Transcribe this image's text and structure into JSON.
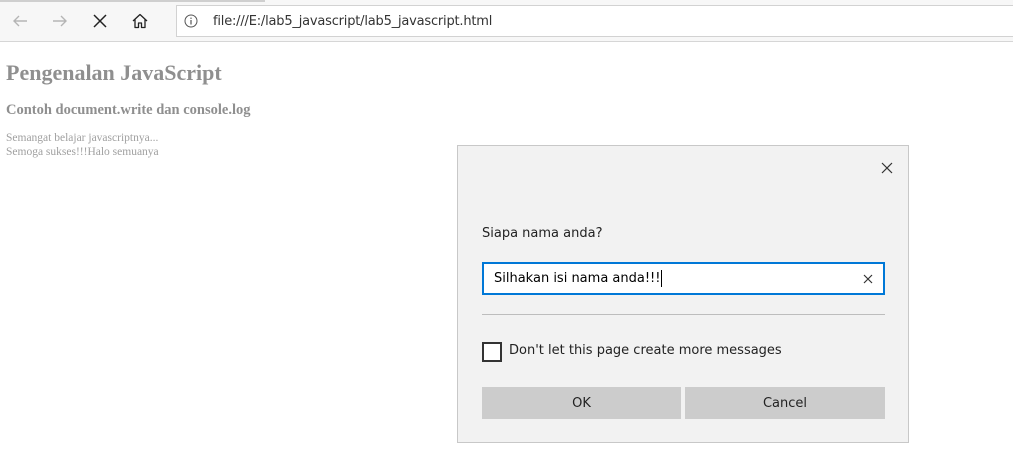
{
  "browser": {
    "address_bar": {
      "url": "file:///E:/lab5_javascript/lab5_javascript.html"
    },
    "icons": {
      "back": "arrow-left-icon",
      "forward": "arrow-right-icon",
      "stop": "close-icon",
      "home": "home-icon",
      "info": "info-icon"
    }
  },
  "page": {
    "heading": "Pengenalan JavaScript",
    "subheading": "Contoh document.write dan console.log",
    "lines": [
      "Semangat belajar javascriptnya...",
      "Semoga sukses!!!Halo semuanya"
    ]
  },
  "dialog": {
    "message": "Siapa nama anda?",
    "input_value": "Silhakan isi nama anda!!!",
    "checkbox_label": "Don't let this page create more messages",
    "checkbox_checked": false,
    "ok_label": "OK",
    "cancel_label": "Cancel",
    "accent_color": "#0078d7"
  }
}
